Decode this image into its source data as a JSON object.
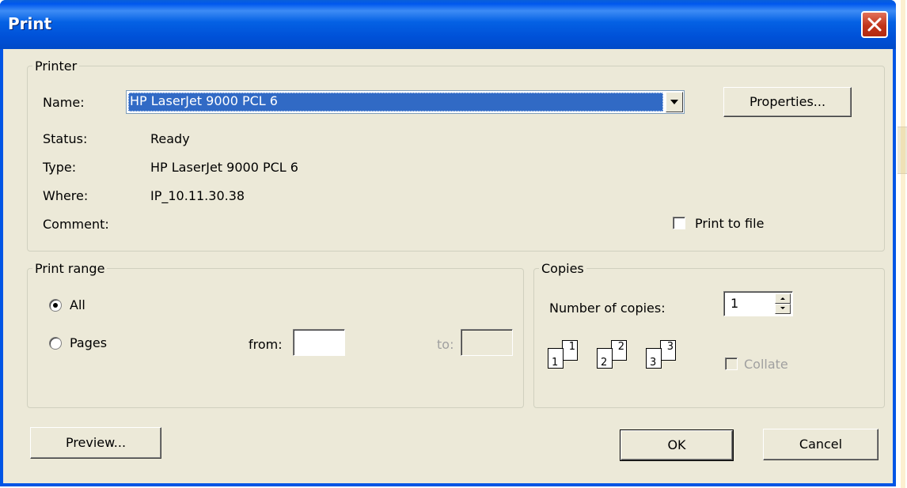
{
  "window": {
    "title": "Print"
  },
  "printer": {
    "group_label": "Printer",
    "name_label": "Name:",
    "name_value": "HP LaserJet 9000 PCL 6",
    "properties_button": "Properties...",
    "status_label": "Status:",
    "status_value": "Ready",
    "type_label": "Type:",
    "type_value": "HP LaserJet 9000 PCL 6",
    "where_label": "Where:",
    "where_value": "IP_10.11.30.38",
    "comment_label": "Comment:",
    "comment_value": "",
    "print_to_file_label": "Print to file",
    "print_to_file_checked": false
  },
  "print_range": {
    "group_label": "Print range",
    "all_label": "All",
    "pages_label": "Pages",
    "selected": "All",
    "from_label": "from:",
    "from_value": "",
    "to_label": "to:",
    "to_value": ""
  },
  "copies": {
    "group_label": "Copies",
    "number_label": "Number of copies:",
    "number_value": "1",
    "collate_label": "Collate",
    "collate_enabled": false,
    "collate_pages": [
      {
        "back": "1",
        "front": "1"
      },
      {
        "back": "2",
        "front": "2"
      },
      {
        "back": "3",
        "front": "3"
      }
    ]
  },
  "buttons": {
    "preview": "Preview...",
    "ok": "OK",
    "cancel": "Cancel"
  },
  "colors": {
    "titlebar": "#0058ee",
    "face": "#ece9d8",
    "selection": "#316ac5",
    "close": "#c0341a"
  },
  "icons": {
    "close": "close-icon",
    "dropdown": "chevron-down-icon",
    "spin_up": "spin-up-icon",
    "spin_down": "spin-down-icon"
  }
}
